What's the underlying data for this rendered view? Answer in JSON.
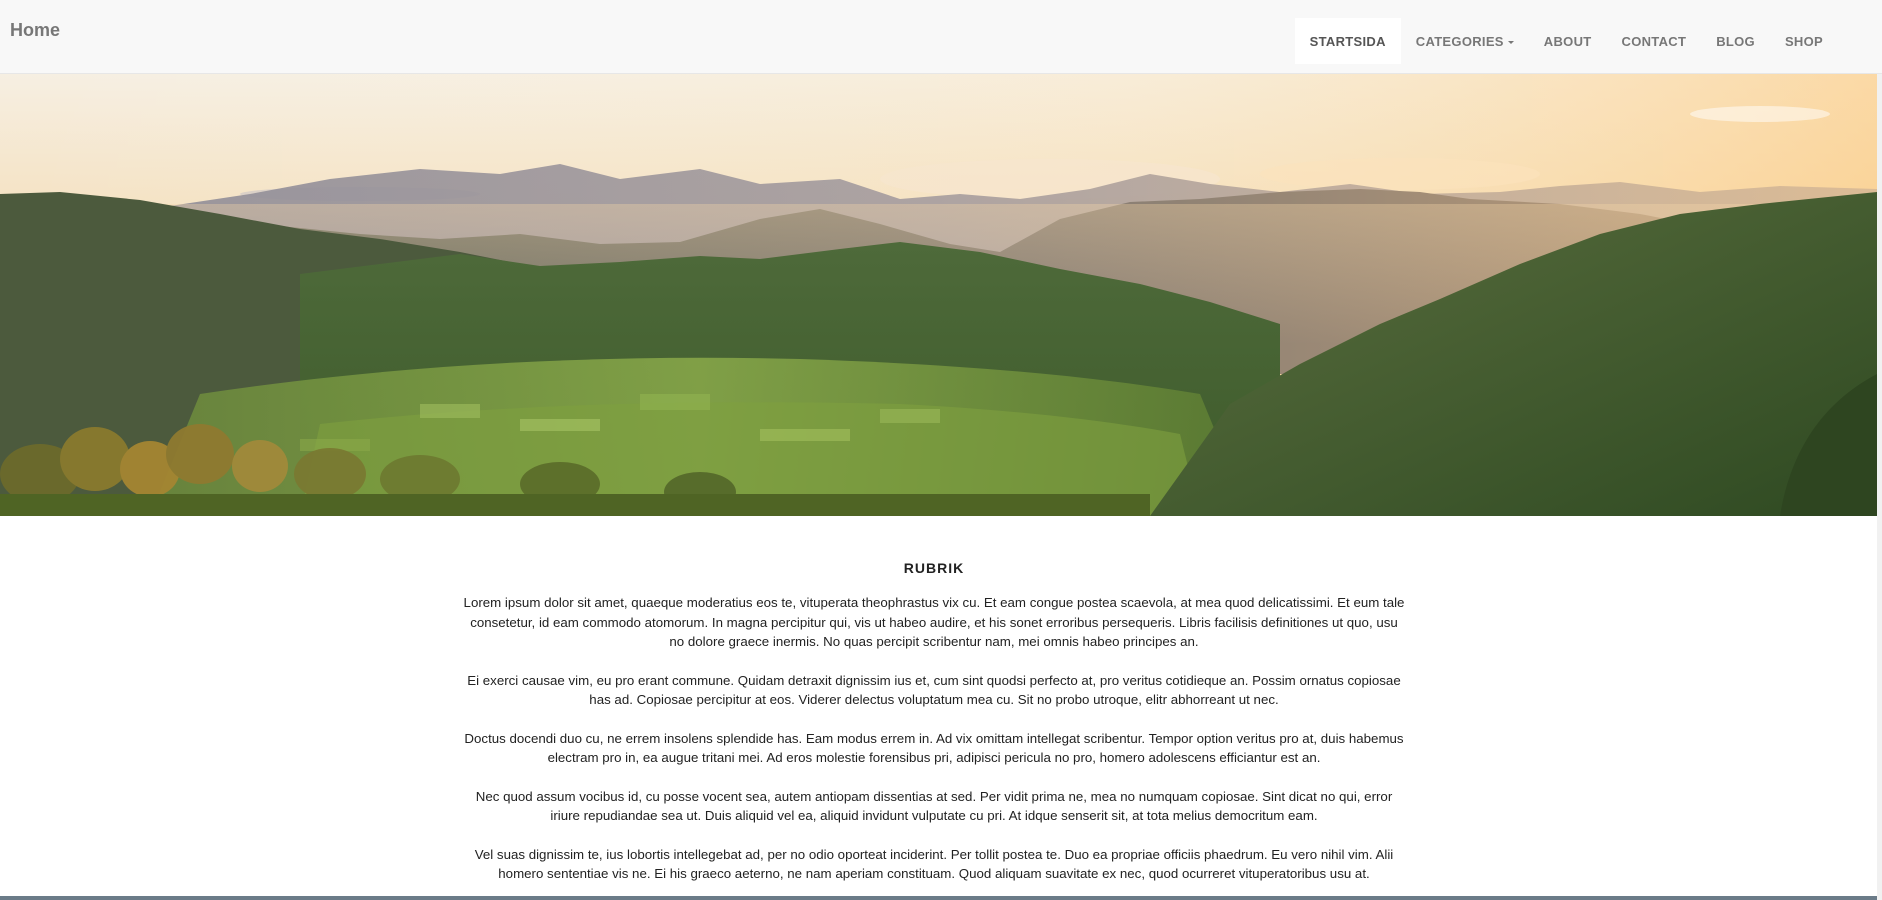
{
  "navbar": {
    "brand": "Home",
    "items": [
      {
        "label": "STARTSIDA",
        "active": true
      },
      {
        "label": "CATEGORIES",
        "dropdown": true
      },
      {
        "label": "ABOUT"
      },
      {
        "label": "CONTACT"
      },
      {
        "label": "BLOG"
      },
      {
        "label": "SHOP"
      }
    ]
  },
  "hero": {
    "image": "mountain-valley-sunset-landscape"
  },
  "content": {
    "heading": "RUBRIK",
    "paragraphs": [
      "Lorem ipsum dolor sit amet, quaeque moderatius eos te, vituperata theophrastus vix cu. Et eam congue postea scaevola, at mea quod delicatissimi. Et eum tale consetetur, id eam commodo atomorum. In magna percipitur qui, vis ut habeo audire, et his sonet erroribus persequeris. Libris facilisis definitiones ut quo, usu no dolore graece inermis. No quas percipit scribentur nam, mei omnis habeo principes an.",
      "Ei exerci causae vim, eu pro erant commune. Quidam detraxit dignissim ius et, cum sint quodsi perfecto at, pro veritus cotidieque an. Possim ornatus copiosae has ad. Copiosae percipitur at eos. Viderer delectus voluptatum mea cu. Sit no probo utroque, elitr abhorreant ut nec.",
      "Doctus docendi duo cu, ne errem insolens splendide has. Eam modus errem in. Ad vix omittam intellegat scribentur. Tempor option veritus pro at, duis habemus electram pro in, ea augue tritani mei. Ad eros molestie forensibus pri, adipisci pericula no pro, homero adolescens efficiantur est an.",
      "Nec quod assum vocibus id, cu posse vocent sea, autem antiopam dissentias at sed. Per vidit prima ne, mea no numquam copiosae. Sint dicat no qui, error iriure repudiandae sea ut. Duis aliquid vel ea, aliquid invidunt vulputate cu pri. At idque senserit sit, at tota melius democritum eam.",
      "Vel suas dignissim te, ius lobortis intellegebat ad, per no odio oporteat inciderint. Per tollit postea te. Duo ea propriae officiis phaedrum. Eu vero nihil vim. Alii homero sententiae vis ne. Ei his graeco aeterno, ne nam aperiam constituam. Quod aliquam suavitate ex nec, quod ocurreret vituperatoribus usu at."
    ]
  },
  "colors": {
    "navbar_bg": "#f8f8f8",
    "nav_text": "#777777",
    "body_text": "#222222"
  }
}
